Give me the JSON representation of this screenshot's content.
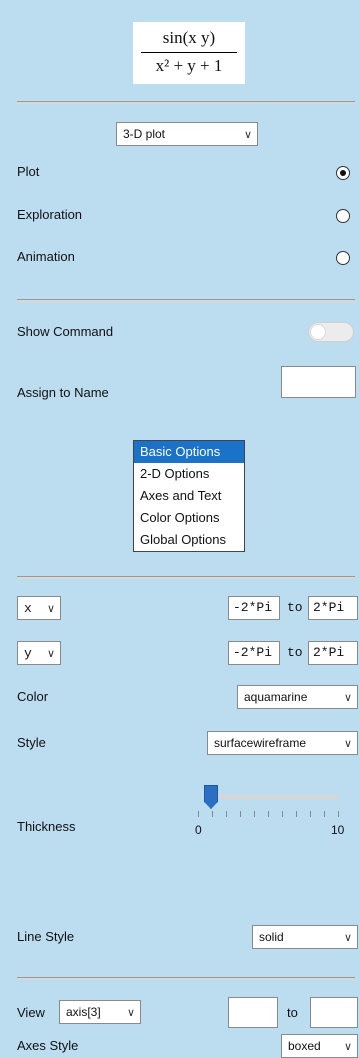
{
  "formula": {
    "numerator": "sin(x y)",
    "denominator": "x² + y + 1"
  },
  "plot_type": {
    "value": "3-D plot"
  },
  "modes": [
    {
      "label": "Plot",
      "selected": true
    },
    {
      "label": "Exploration",
      "selected": false
    },
    {
      "label": "Animation",
      "selected": false
    }
  ],
  "show_command": {
    "label": "Show Command",
    "on": false
  },
  "assign_name": {
    "label": "Assign to Name",
    "value": ""
  },
  "option_list": {
    "items": [
      "Basic Options",
      "2-D Options",
      "Axes and Text",
      "Color Options",
      "Global Options"
    ],
    "selected": "Basic Options"
  },
  "ranges": [
    {
      "var": "x",
      "from": "-2*Pi",
      "to_label": "to",
      "to": "2*Pi"
    },
    {
      "var": "y",
      "from": "-2*Pi",
      "to_label": "to",
      "to": "2*Pi"
    }
  ],
  "color": {
    "label": "Color",
    "value": "aquamarine"
  },
  "style": {
    "label": "Style",
    "value": "surfacewireframe"
  },
  "thickness": {
    "label": "Thickness",
    "min": "0",
    "max": "10",
    "value": 1
  },
  "line_style": {
    "label": "Line Style",
    "value": "solid"
  },
  "view": {
    "label": "View",
    "value": "axis[3]",
    "to_label": "to",
    "from_val": "",
    "to_val": ""
  },
  "axes_style": {
    "label": "Axes Style",
    "value": "boxed"
  }
}
